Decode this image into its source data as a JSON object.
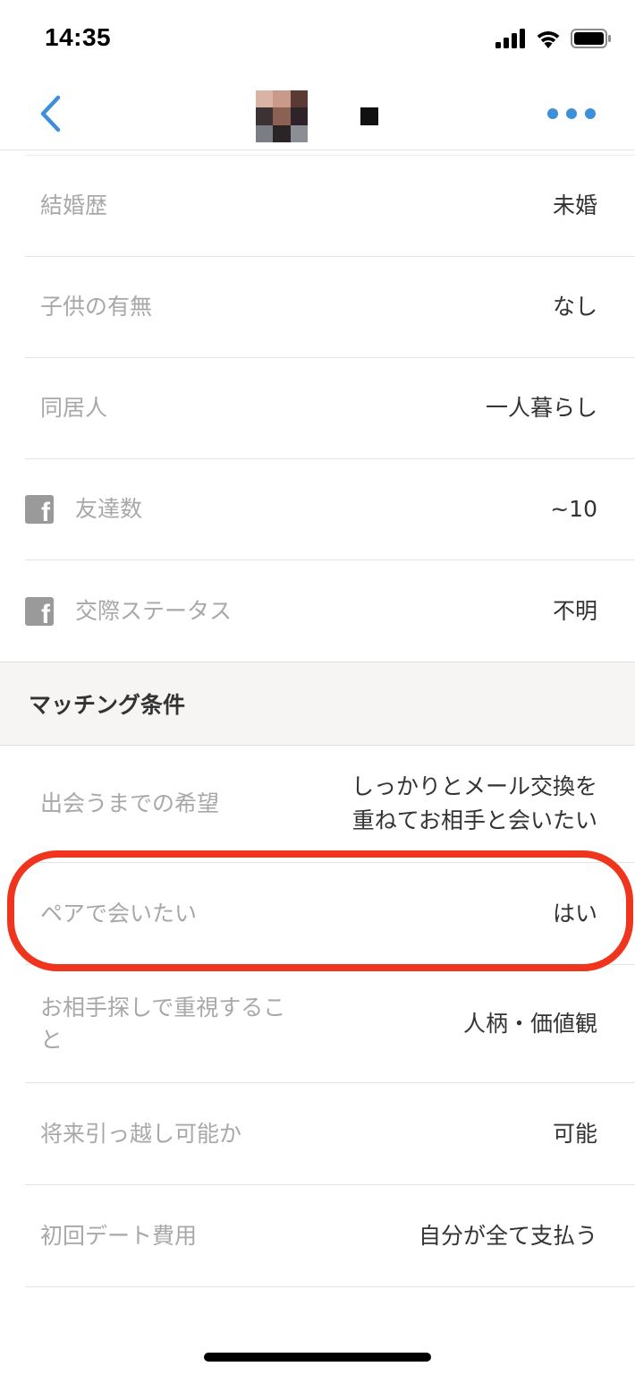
{
  "status_bar": {
    "time": "14:35",
    "icons": [
      "signal-icon",
      "wifi-icon",
      "battery-icon"
    ]
  },
  "nav": {
    "back_icon": "chevron-left-icon",
    "more_icon": "more-dots-icon",
    "accent_color": "#3d8fd9"
  },
  "profile_rows": [
    {
      "label": "結婚歴",
      "value": "未婚"
    },
    {
      "label": "子供の有無",
      "value": "なし"
    },
    {
      "label": "同居人",
      "value": "一人暮らし"
    },
    {
      "label": "友達数",
      "value": "~10",
      "icon": "facebook-icon"
    },
    {
      "label": "交際ステータス",
      "value": "不明",
      "icon": "facebook-icon"
    }
  ],
  "matching_section": {
    "title": "マッチング条件",
    "rows": [
      {
        "label": "出会うまでの希望",
        "value_line1": "しっかりとメール交換を",
        "value_line2": "重ねてお相手と会いたい"
      },
      {
        "label": "ペアで会いたい",
        "value": "はい"
      },
      {
        "label_line1": "お相手探しで重視するこ",
        "label_line2": "と",
        "value": "人柄・価値観"
      },
      {
        "label": "将来引っ越し可能か",
        "value": "可能"
      },
      {
        "label": "初回デート費用",
        "value": "自分が全て支払う"
      }
    ]
  },
  "highlight_color": "#f0351e"
}
